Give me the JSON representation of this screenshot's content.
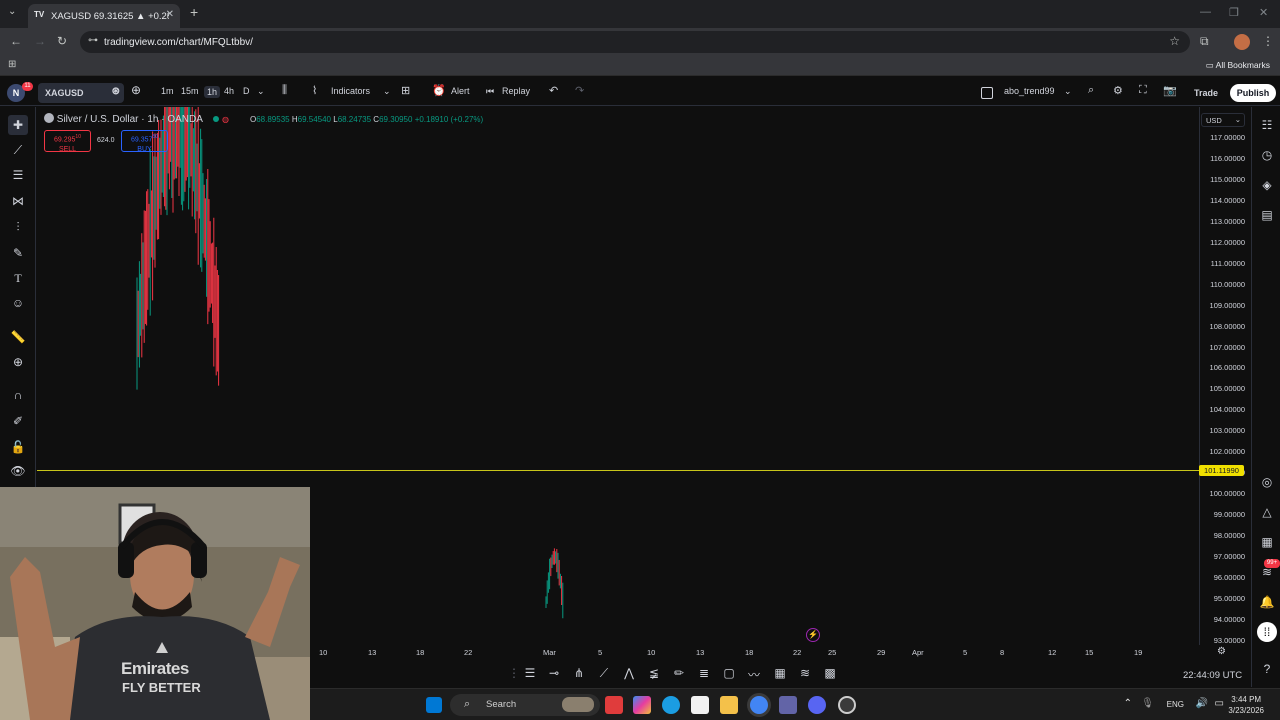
{
  "browser": {
    "tab_title": "XAGUSD 69.31625 ▲ +0.28% Si",
    "url": "tradingview.com/chart/MFQLtbbv/",
    "all_bookmarks": "All Bookmarks"
  },
  "toolbar": {
    "avatar_letter": "N",
    "notification_count": "11",
    "symbol": "XAGUSD",
    "timeframes": [
      "1m",
      "15m",
      "1h",
      "4h",
      "D"
    ],
    "selected_timeframe": "1h",
    "indicators_label": "Indicators",
    "alert_label": "Alert",
    "replay_label": "Replay",
    "layout_name": "abo_trend99",
    "trade_label": "Trade",
    "publish_label": "Publish"
  },
  "legend": {
    "title": "Silver / U.S. Dollar · 1h · OANDA",
    "open_label": "O",
    "open": "68.89535",
    "high_label": "H",
    "high": "69.54540",
    "low_label": "L",
    "low": "68.24735",
    "close_label": "C",
    "close": "69.30950",
    "change": "+0.18910 (+0.27%)",
    "sell_price": "69.295",
    "sell_price_sup": "10",
    "sell_label": "SELL",
    "spread": "624.0",
    "buy_price": "69.357",
    "buy_price_sup": "50",
    "buy_label": "BUY"
  },
  "currency": "USD",
  "price_axis": [
    "117.00000",
    "116.00000",
    "115.00000",
    "114.00000",
    "113.00000",
    "112.00000",
    "111.00000",
    "110.00000",
    "109.00000",
    "108.00000",
    "107.00000",
    "106.00000",
    "105.00000",
    "104.00000",
    "103.00000",
    "102.00000",
    "101.00000",
    "100.00000",
    "99.00000",
    "98.00000",
    "97.00000",
    "96.00000",
    "95.00000",
    "94.00000",
    "93.00000"
  ],
  "horizontal_line_price": "101.11990",
  "time_axis": [
    "10",
    "13",
    "18",
    "22",
    "Mar",
    "5",
    "10",
    "13",
    "18",
    "22",
    "25",
    "29",
    "Apr",
    "5",
    "8",
    "12",
    "15",
    "19"
  ],
  "utc_clock": "22:44:09 UTC",
  "colors": {
    "up": "#089981",
    "down": "#f23645",
    "hline": "#c7c51a",
    "hline_label_bg": "#f0e000",
    "accent": "#2962ff"
  },
  "chart_data": {
    "type": "candlestick",
    "title": "Silver / U.S. Dollar · 1h · OANDA",
    "ylim": [
      92.6,
      117.5
    ],
    "visible_segments": [
      {
        "x_range": [
          "Feb ~5",
          "Feb ~8"
        ],
        "low": 101.0,
        "high": 117.5,
        "note": "dense cluster, partially off-screen top"
      },
      {
        "x_range": [
          "Mar 1",
          "Mar 2"
        ],
        "low": 92.8,
        "high": 96.4
      }
    ],
    "last_close": 69.3095
  },
  "taskbar": {
    "search_label": "Search",
    "language": "ENG",
    "time": "3:44 PM",
    "date": "3/23/2026"
  }
}
